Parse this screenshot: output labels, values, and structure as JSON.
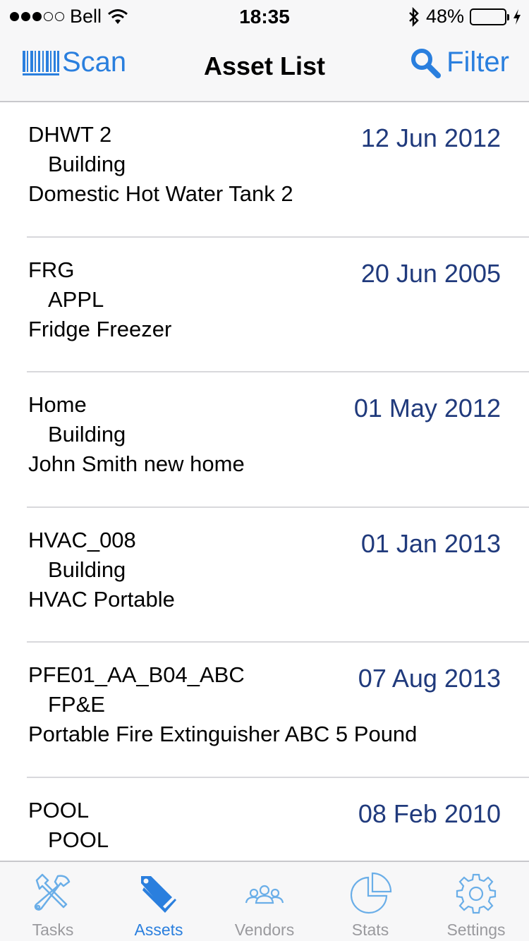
{
  "status_bar": {
    "carrier": "Bell",
    "time": "18:35",
    "battery": "48%",
    "battery_level": 0.48,
    "icons": [
      "signal-dots-icon",
      "wifi-icon",
      "bluetooth-icon",
      "battery-icon",
      "charging-bolt-icon"
    ]
  },
  "nav": {
    "scan_label": "Scan",
    "title": "Asset List",
    "filter_label": "Filter",
    "icons": [
      "barcode-icon",
      "search-icon"
    ]
  },
  "assets": [
    {
      "code": "DHWT 2",
      "category": "Building",
      "description": "Domestic Hot Water Tank 2",
      "date": "12 Jun 2012"
    },
    {
      "code": "FRG",
      "category": "APPL",
      "description": "Fridge Freezer",
      "date": "20 Jun 2005"
    },
    {
      "code": "Home",
      "category": "Building",
      "description": "John Smith new home",
      "date": "01 May 2012"
    },
    {
      "code": "HVAC_008",
      "category": "Building",
      "description": "HVAC Portable",
      "date": "01 Jan 2013"
    },
    {
      "code": "PFE01_AA_B04_ABC",
      "category": "FP&E",
      "description": "Portable Fire Extinguisher ABC 5 Pound",
      "date": "07 Aug 2013"
    },
    {
      "code": "POOL",
      "category": "POOL",
      "description": "",
      "date": "08 Feb 2010"
    }
  ],
  "tabs": [
    {
      "label": "Tasks",
      "icon": "tools-icon",
      "active": false
    },
    {
      "label": "Assets",
      "icon": "tags-icon",
      "active": true
    },
    {
      "label": "Vendors",
      "icon": "people-icon",
      "active": false
    },
    {
      "label": "Stats",
      "icon": "pie-chart-icon",
      "active": false
    },
    {
      "label": "Settings",
      "icon": "gear-icon",
      "active": false
    }
  ],
  "colors": {
    "accent": "#2a7fde",
    "date_text": "#203a7c",
    "inactive_tab": "#9a9a9e",
    "battery_fill": "#4cd964"
  }
}
